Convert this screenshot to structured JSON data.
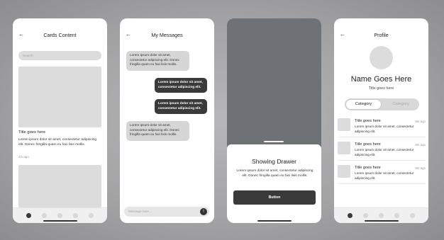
{
  "screens": {
    "cards": {
      "title": "Cards Content",
      "search_placeholder": "Search",
      "card": {
        "title": "Title goes here",
        "body": "Lorem ipsum dolor sit amet, consectetur adipiscing elit. Donec fringilla quam eu faci lisis mollis.",
        "time": "4m ago"
      }
    },
    "messages": {
      "title": "My Messages",
      "items": [
        {
          "direction": "in",
          "text": "Lorem ipsum dolor sit amet, consectetur adipiscing elit. Donec fringilla quam eu faci lisis mollis."
        },
        {
          "direction": "out",
          "text": "Lorem ipsum dolor sit amet, consectetur adipiscing elit."
        },
        {
          "direction": "out",
          "text": "Lorem ipsum dolor sit amet, consectetur adipiscing elit."
        },
        {
          "direction": "in",
          "text": "Lorem ipsum dolor sit amet, consectetur adipiscing elit. Donec fringilla quam eu faci lisis mollis."
        }
      ],
      "input_placeholder": "Message here...",
      "send_icon": "↑"
    },
    "drawer": {
      "title": "Showing Drawer",
      "body": "Lorem ipsum dolor sit amet, consectetur adipiscing elit. Donec fringilla quam eu faci lisis mollis.",
      "button_label": "Button"
    },
    "profile": {
      "title": "Profile",
      "name": "Name Goes Here",
      "subtitle": "Title goes here",
      "segments": [
        "Category",
        "Category"
      ],
      "list": [
        {
          "title": "Title goes here",
          "time": "8m ago",
          "body": "Lorem ipsum dolor sit amet, consectetur adipiscing elit."
        },
        {
          "title": "Title goes here",
          "time": "8m ago",
          "body": "Lorem ipsum dolor sit amet, consectetur adipiscing elit."
        },
        {
          "title": "Title goes here",
          "time": "8m ago",
          "body": "Lorem ipsum dolor sit amet, consectetur adipiscing elit."
        }
      ]
    }
  },
  "common": {
    "back_icon": "←"
  },
  "colors": {
    "dark": "#3a3a3a",
    "placeholder": "#dcdcdc",
    "drawer_overlay": "#6e7176"
  }
}
